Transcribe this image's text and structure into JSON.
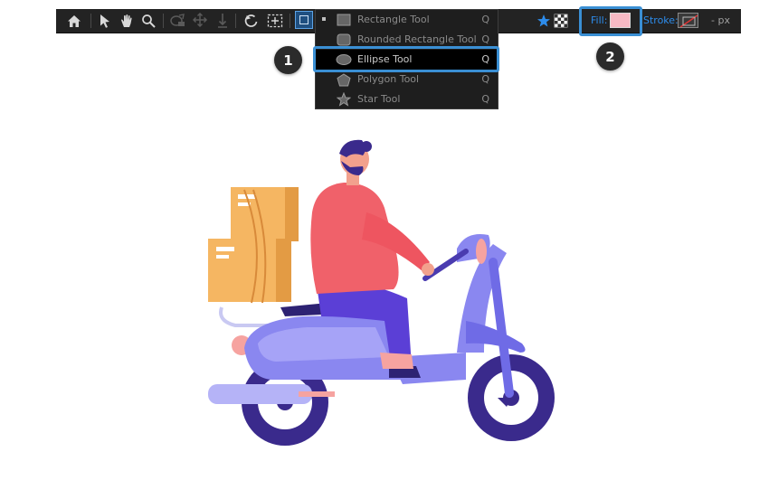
{
  "toolbar": {
    "tools": [
      {
        "name": "home-icon"
      },
      {
        "name": "selection-tool-icon"
      },
      {
        "name": "hand-tool-icon"
      },
      {
        "name": "zoom-tool-icon"
      },
      {
        "name": "orbit-camera-icon"
      },
      {
        "name": "pan-camera-icon"
      },
      {
        "name": "dolly-camera-icon"
      },
      {
        "name": "rotation-tool-icon"
      },
      {
        "name": "pan-behind-tool-icon"
      },
      {
        "name": "shape-tool-icon"
      }
    ],
    "fill_label": "Fill:",
    "fill_color": "#f7b9c4",
    "stroke_label": "Stroke:",
    "units": "- px",
    "toggles": [
      {
        "name": "star-toggle-icon"
      },
      {
        "name": "checker-toggle-icon"
      }
    ]
  },
  "shape_menu": {
    "items": [
      {
        "label": "Rectangle Tool",
        "shortcut": "Q",
        "icon": "rectangle-icon",
        "checked": true
      },
      {
        "label": "Rounded Rectangle Tool",
        "shortcut": "Q",
        "icon": "rounded-rectangle-icon"
      },
      {
        "label": "Ellipse Tool",
        "shortcut": "Q",
        "icon": "ellipse-icon",
        "highlighted": true
      },
      {
        "label": "Polygon Tool",
        "shortcut": "Q",
        "icon": "polygon-icon"
      },
      {
        "label": "Star Tool",
        "shortcut": "Q",
        "icon": "star-icon"
      }
    ]
  },
  "callouts": {
    "step1": "1",
    "step2": "2",
    "color": "#3a8fd4"
  },
  "illustration": {
    "description_icon": "delivery-scooter-illustration"
  }
}
